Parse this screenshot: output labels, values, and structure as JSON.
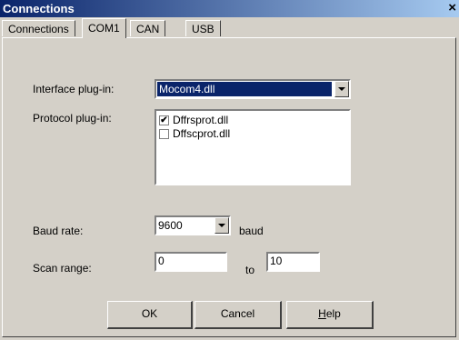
{
  "window": {
    "title": "Connections",
    "close_glyph": "×"
  },
  "tabs": [
    {
      "label": "Connections"
    },
    {
      "label": "COM1"
    },
    {
      "label": "CAN"
    },
    {
      "label": "USB"
    }
  ],
  "interface_plugin": {
    "label": "Interface plug-in:",
    "value": "Mocom4.dll"
  },
  "protocol_plugin": {
    "label": "Protocol plug-in:",
    "items": [
      {
        "label": "Dffrsprot.dll",
        "checked": true,
        "mark": "✔"
      },
      {
        "label": "Dffscprot.dll",
        "checked": false,
        "mark": ""
      }
    ]
  },
  "baud": {
    "label": "Baud rate:",
    "value": "9600",
    "unit": "baud"
  },
  "scan": {
    "label": "Scan range:",
    "from": "0",
    "to_label": "to",
    "to": "10"
  },
  "buttons": {
    "ok": "OK",
    "cancel": "Cancel",
    "help_prefix": "",
    "help_mnemonic": "H",
    "help_rest": "elp"
  }
}
